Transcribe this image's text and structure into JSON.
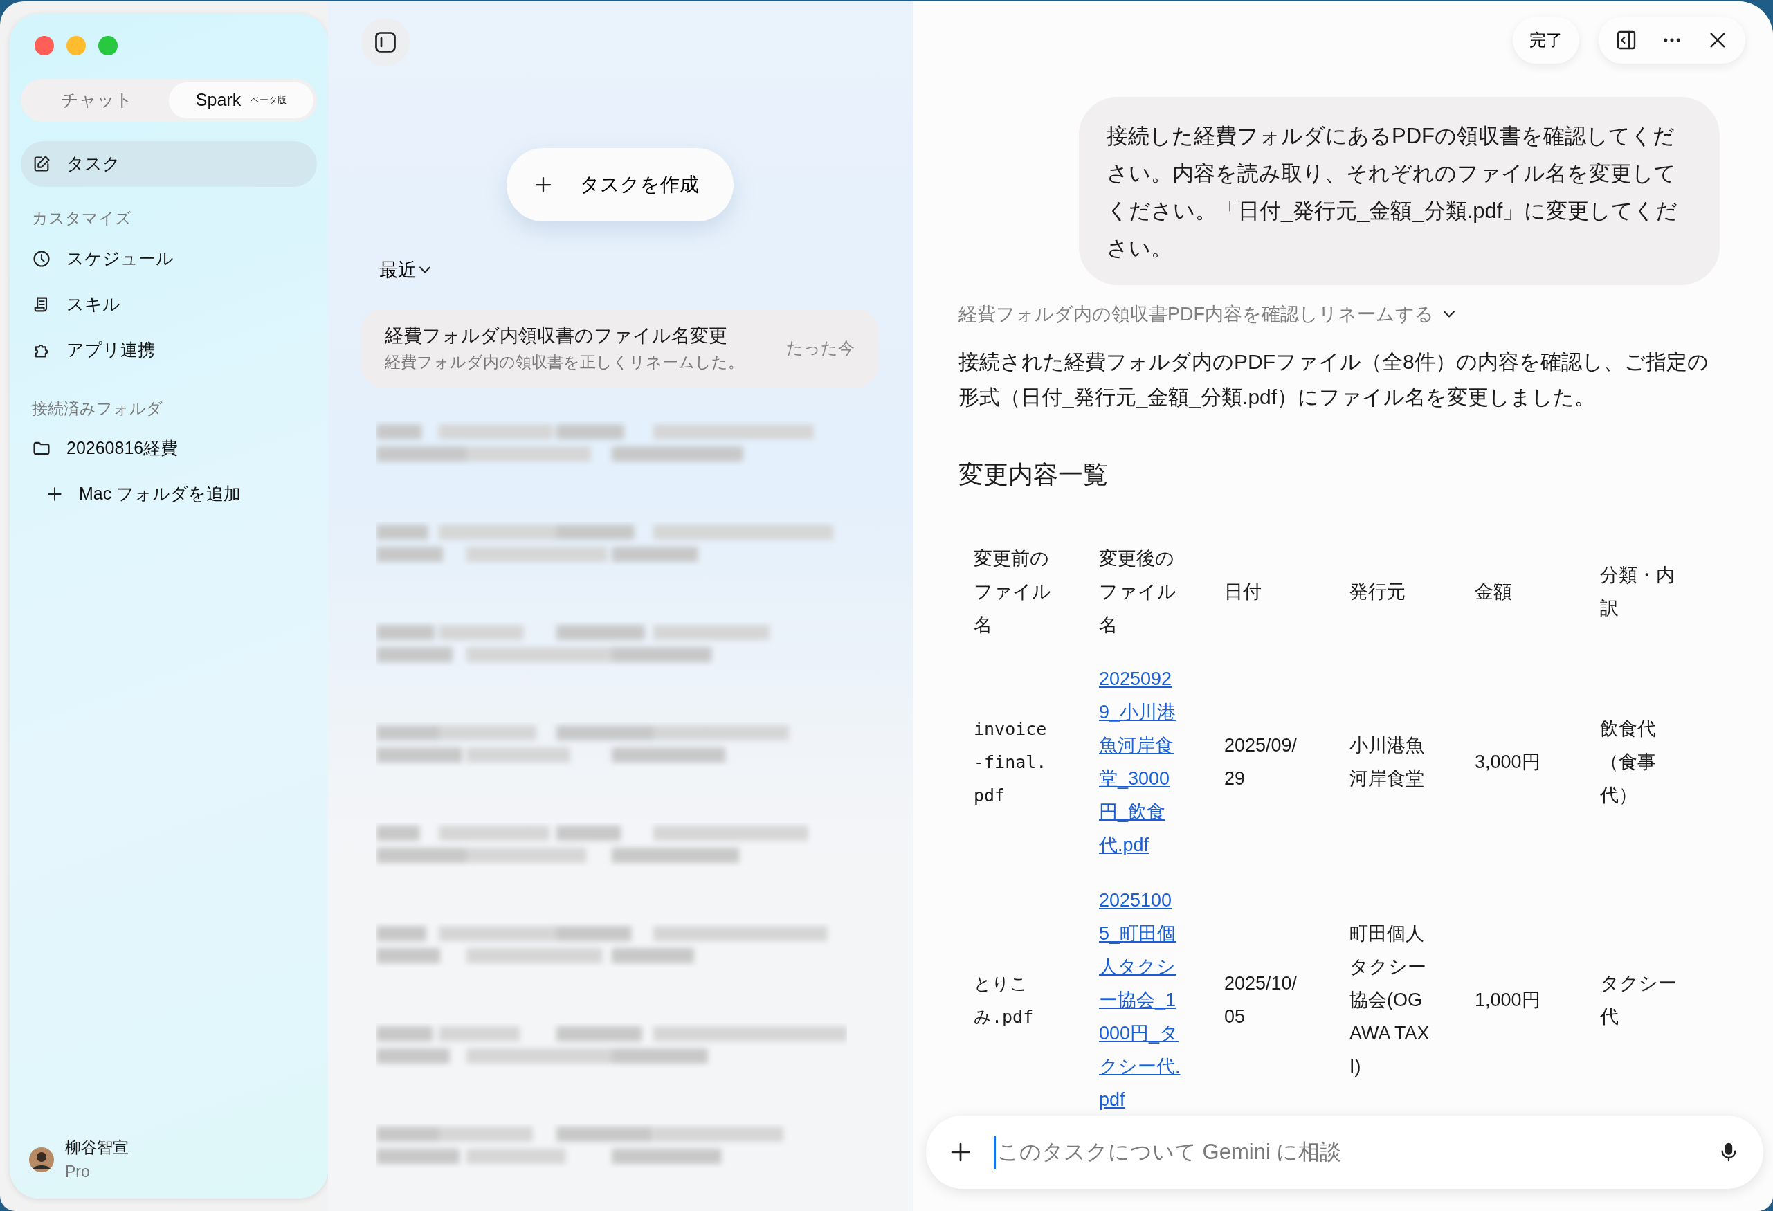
{
  "window": {
    "traffic_lights": [
      {
        "color": "#ff5f57"
      },
      {
        "color": "#febc2e"
      },
      {
        "color": "#28c840"
      }
    ]
  },
  "sidebar": {
    "mode_tabs": [
      {
        "label": "チャット",
        "selected": false
      },
      {
        "label": "Spark",
        "badge": "ベータ版",
        "selected": true
      }
    ],
    "nav": [
      {
        "label": "タスク",
        "kind": "task",
        "selected": true
      }
    ],
    "customize": {
      "heading": "カスタマイズ",
      "items": [
        {
          "label": "スケジュール",
          "kind": "schedule",
          "selected": false
        },
        {
          "label": "スキル",
          "kind": "skill",
          "selected": false
        },
        {
          "label": "アプリ連携",
          "kind": "apps",
          "selected": false
        }
      ]
    },
    "folders": {
      "heading": "接続済みフォルダ",
      "items": [
        {
          "label": "20260816経費"
        }
      ],
      "add_label": "Mac フォルダを追加"
    },
    "user": {
      "name": "柳谷智宣",
      "plan": "Pro"
    }
  },
  "task_list": {
    "create_button": "タスクを作成",
    "filter": "最近",
    "tasks": [
      {
        "kind": "task",
        "title": "経費フォルダ内領収書のファイル名変更",
        "subtitle": "経費フォルダ内の領収書を正しくリネームした。",
        "time": "たった今",
        "selected": true
      },
      {
        "kind": "redacted"
      },
      {
        "kind": "redacted"
      },
      {
        "kind": "redacted"
      },
      {
        "kind": "redacted"
      },
      {
        "kind": "redacted"
      },
      {
        "kind": "redacted"
      },
      {
        "kind": "redacted"
      },
      {
        "kind": "redacted"
      }
    ]
  },
  "detail": {
    "done_button": "完了",
    "user_message": "接続した経費フォルダにあるPDFの領収書を確認してください。内容を読み取り、それぞれのファイル名を変更してください。「日付_発行元_金額_分類.pdf」に変更してください。",
    "thinking_label": "経費フォルダ内の領収書PDF内容を確認しリネームする",
    "response": "接続された経費フォルダ内のPDFファイル（全8件）の内容を確認し、ご指定の形式（日付_発行元_金額_分類.pdf）にファイル名を変更しました。",
    "section_title": "変更内容一覧",
    "table": {
      "columns": [
        "変更前のファイル名",
        "変更後のファイル名",
        "日付",
        "発行元",
        "金額",
        "分類・内訳"
      ],
      "rows": [
        [
          "invoice-final.pdf",
          "20250929_小川港魚河岸食堂_3000円_飲食代.pdf",
          "2025/09/29",
          "小川港魚河岸食堂",
          "3,000円",
          "飲食代（食事代）"
        ],
        [
          "とりこみ.pdf",
          "20251005_町田個人タクシー協会_1000円_タクシー代.pdf",
          "2025/10/05",
          "町田個人タクシー協会(OGAWA TAXI)",
          "1,000円",
          "タクシー代"
        ]
      ]
    },
    "input": {
      "placeholder": "このタスクについて Gemini に相談"
    }
  }
}
